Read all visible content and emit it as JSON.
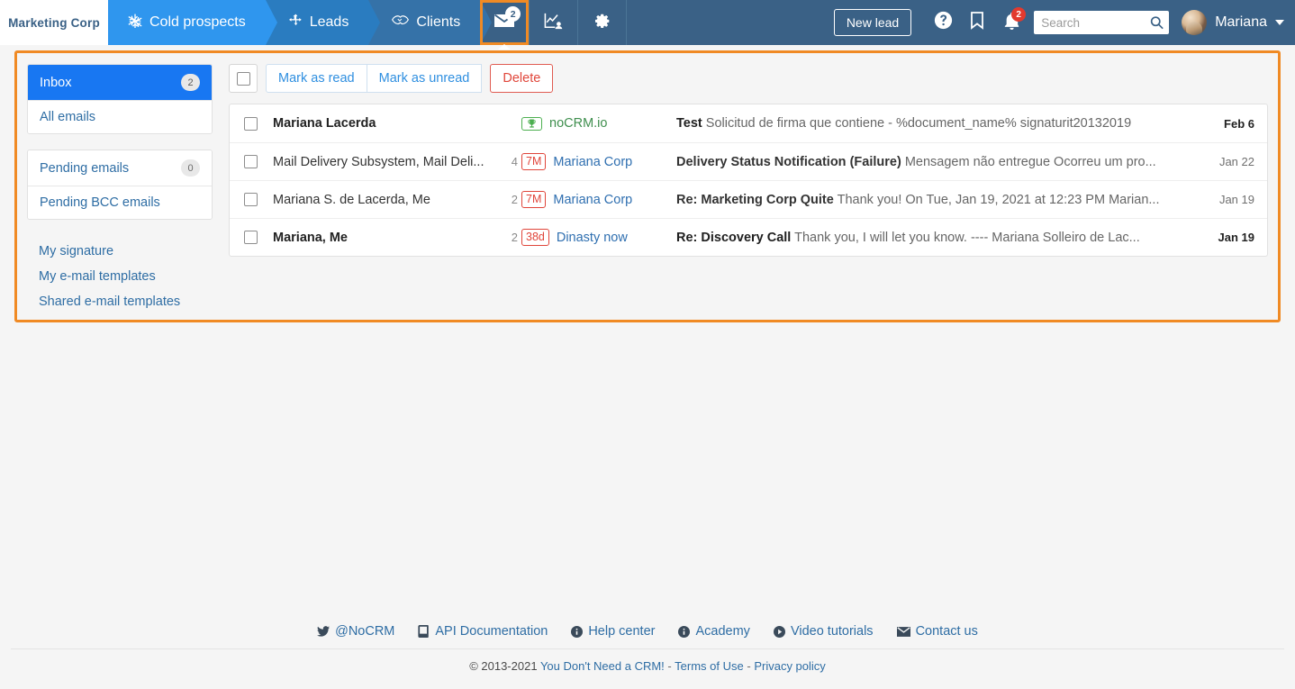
{
  "topbar": {
    "brand": "Marketing Corp",
    "tabs": [
      {
        "label": "Cold prospects",
        "icon": "snowflake-icon"
      },
      {
        "label": "Leads",
        "icon": "compass-icon"
      },
      {
        "label": "Clients",
        "icon": "handshake-icon"
      }
    ],
    "mail_tab": {
      "icon": "envelope-icon",
      "count": "2",
      "selected": true
    },
    "stats_tab": {
      "icon": "chart-user-icon"
    },
    "settings_tab": {
      "icon": "gear-icon"
    },
    "new_lead_label": "New lead",
    "help_icon": "question-circle-icon",
    "bookmark_icon": "bookmark-icon",
    "bell_icon": "bell-icon",
    "bell_count": "2",
    "search": {
      "placeholder": "Search",
      "value": "",
      "icon": "search-icon"
    },
    "user": {
      "name": "Mariana",
      "avatar": "user-avatar",
      "caret": "chevron-down-icon"
    }
  },
  "sidebar": {
    "group1": [
      {
        "label": "Inbox",
        "count": "2",
        "active": true
      },
      {
        "label": "All emails",
        "count": "",
        "active": false
      }
    ],
    "group2": [
      {
        "label": "Pending emails",
        "count": "0",
        "active": false
      },
      {
        "label": "Pending BCC emails",
        "count": "",
        "active": false
      }
    ],
    "links": [
      {
        "label": "My signature"
      },
      {
        "label": "My e-mail templates"
      },
      {
        "label": "Shared e-mail templates"
      }
    ]
  },
  "toolbar": {
    "select_all_name": "select-all-checkbox",
    "mark_read_label": "Mark as read",
    "mark_unread_label": "Mark as unread",
    "delete_label": "Delete"
  },
  "mail_list": {
    "rows": [
      {
        "sender": "Mariana Lacerda",
        "unread": true,
        "count": "",
        "tag": "",
        "tag_type": "trophy",
        "tag_link": "noCRM.io",
        "subject": "Test",
        "preview": "Solicitud de firma que contiene - %document_name% signaturit20132019",
        "date": "Feb 6"
      },
      {
        "sender": "Mail Delivery Subsystem, Mail Deli...",
        "unread": false,
        "count": "4",
        "tag": "7M",
        "tag_type": "age",
        "tag_link": "Mariana Corp",
        "subject": "Delivery Status Notification (Failure)",
        "preview": "Mensagem não entregue Ocorreu um pro...",
        "date": "Jan 22"
      },
      {
        "sender": "Mariana S. de Lacerda, Me",
        "unread": false,
        "count": "2",
        "tag": "7M",
        "tag_type": "age",
        "tag_link": "Mariana Corp",
        "subject": "Re: Marketing Corp Quite",
        "preview": "Thank you! On Tue, Jan 19, 2021 at 12:23 PM Marian...",
        "date": "Jan 19"
      },
      {
        "sender": "Mariana, Me",
        "unread": true,
        "count": "2",
        "tag": "38d",
        "tag_type": "age",
        "tag_link": "Dinasty now",
        "subject": "Re: Discovery Call",
        "preview": "Thank you, I will let you know.  ---- Mariana Solleiro de Lac...",
        "date": "Jan 19"
      }
    ]
  },
  "footer": {
    "links": [
      {
        "label": "@NoCRM",
        "icon": "twitter-icon"
      },
      {
        "label": "API Documentation",
        "icon": "book-icon"
      },
      {
        "label": "Help center",
        "icon": "info-icon"
      },
      {
        "label": "Academy",
        "icon": "info-icon"
      },
      {
        "label": "Video tutorials",
        "icon": "play-circle-icon"
      },
      {
        "label": "Contact us",
        "icon": "envelope-icon"
      }
    ],
    "copyright": "© 2013-2021",
    "brand_link": "You Don't Need a CRM!",
    "terms_link": "Terms of Use",
    "privacy_link": "Privacy policy",
    "separator": "-"
  },
  "colors": {
    "header_bg": "#3a6186",
    "accent_orange": "#f08a24",
    "active_blue": "#1877f2",
    "tab_blue": "#2f96ee",
    "danger_red": "#e0453a",
    "green": "#4caf50",
    "link_blue": "#2e6da4"
  }
}
